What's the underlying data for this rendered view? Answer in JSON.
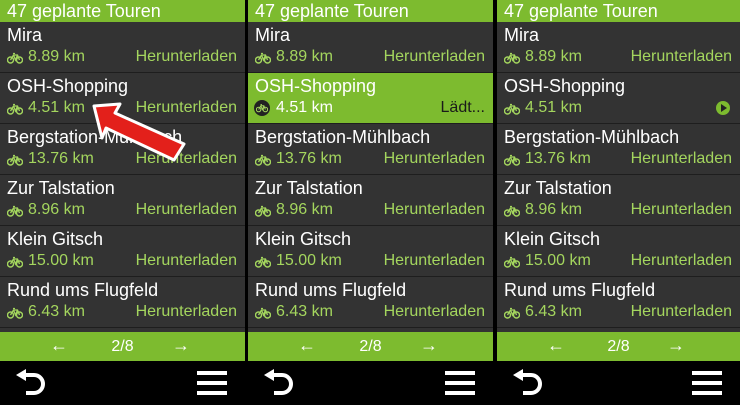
{
  "screens": [
    {
      "title": "47 geplante Touren",
      "rows": [
        {
          "name": "Mira",
          "distance": "8.89 km",
          "status": "Herunterladen"
        },
        {
          "name": "OSH-Shopping",
          "distance": "4.51 km",
          "status": "Herunterladen"
        },
        {
          "name": "Bergstation-Mühlbach",
          "distance": "13.76 km",
          "status": "Herunterladen"
        },
        {
          "name": "Zur Talstation",
          "distance": "8.96 km",
          "status": "Herunterladen"
        },
        {
          "name": "Klein Gitsch",
          "distance": "15.00 km",
          "status": "Herunterladen"
        },
        {
          "name": "Rund ums Flugfeld",
          "distance": "6.43 km",
          "status": "Herunterladen"
        }
      ],
      "pager": {
        "prev": "←",
        "page": "2/8",
        "next": "→"
      }
    },
    {
      "title": "47 geplante Touren",
      "rows": [
        {
          "name": "Mira",
          "distance": "8.89 km",
          "status": "Herunterladen"
        },
        {
          "name": "OSH-Shopping",
          "distance": "4.51 km",
          "status": "Lädt..."
        },
        {
          "name": "Bergstation-Mühlbach",
          "distance": "13.76 km",
          "status": "Herunterladen"
        },
        {
          "name": "Zur Talstation",
          "distance": "8.96 km",
          "status": "Herunterladen"
        },
        {
          "name": "Klein Gitsch",
          "distance": "15.00 km",
          "status": "Herunterladen"
        },
        {
          "name": "Rund ums Flugfeld",
          "distance": "6.43 km",
          "status": "Herunterladen"
        }
      ],
      "pager": {
        "prev": "←",
        "page": "2/8",
        "next": "→"
      }
    },
    {
      "title": "47 geplante Touren",
      "rows": [
        {
          "name": "Mira",
          "distance": "8.89 km",
          "status": "Herunterladen"
        },
        {
          "name": "OSH-Shopping",
          "distance": "4.51 km",
          "status": ""
        },
        {
          "name": "Bergstation-Mühlbach",
          "distance": "13.76 km",
          "status": "Herunterladen"
        },
        {
          "name": "Zur Talstation",
          "distance": "8.96 km",
          "status": "Herunterladen"
        },
        {
          "name": "Klein Gitsch",
          "distance": "15.00 km",
          "status": "Herunterladen"
        },
        {
          "name": "Rund ums Flugfeld",
          "distance": "6.43 km",
          "status": "Herunterladen"
        }
      ],
      "pager": {
        "prev": "←",
        "page": "2/8",
        "next": "→"
      }
    }
  ],
  "icons": {
    "route": "bike-icon",
    "back": "back-icon",
    "menu": "menu-icon",
    "play": "play-icon",
    "annotation": "arrow-annotation"
  },
  "colors": {
    "accent": "#7dbb2f",
    "accent_text": "#a4d65e",
    "background": "#333333",
    "bar": "#000000",
    "annotation": "#e3201b"
  }
}
